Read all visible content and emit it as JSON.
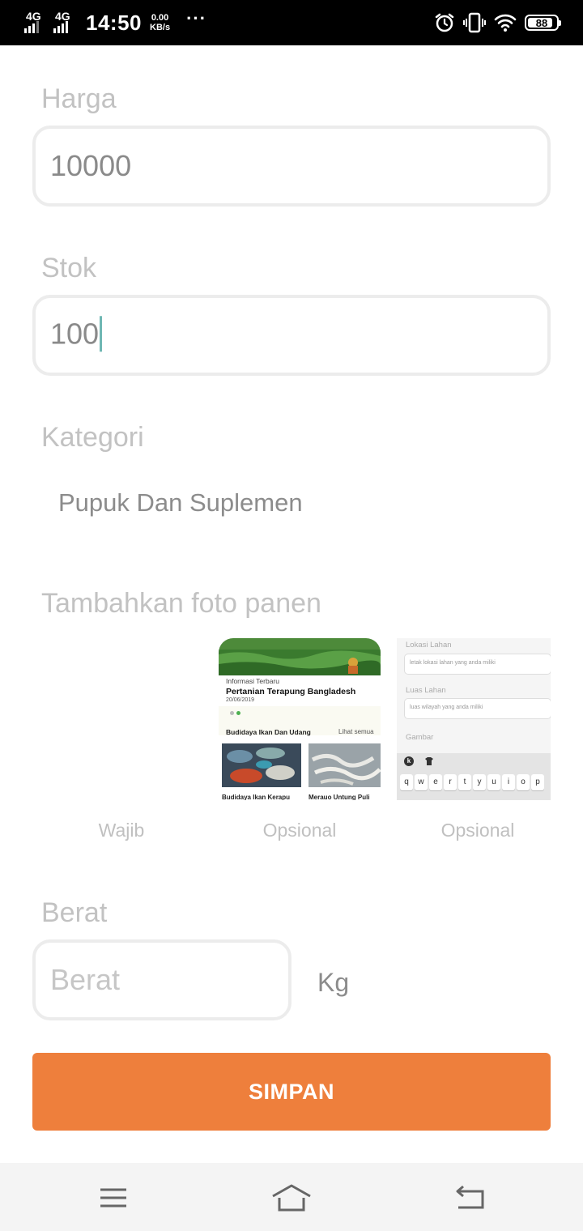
{
  "status_bar": {
    "network_1": "4G",
    "network_2": "4G",
    "time": "14:50",
    "speed_value": "0.00",
    "speed_unit": "KB/s",
    "more": "···",
    "battery_level": "88"
  },
  "form": {
    "harga": {
      "label": "Harga",
      "value": "10000"
    },
    "stok": {
      "label": "Stok",
      "value": "100"
    },
    "kategori": {
      "label": "Kategori",
      "selected": "Pupuk Dan Suplemen"
    },
    "photos": {
      "label": "Tambahkan foto panen",
      "slots": [
        {
          "caption": "Wajib"
        },
        {
          "caption": "Opsional",
          "thumb": {
            "header": "Informasi Terbaru",
            "title": "Pertanian Terapung Bangladesh",
            "date": "20/06/2019",
            "section": "Budidaya Ikan Dan Udang",
            "link": "Lihat semua",
            "card_1": "Budidaya Ikan Kerapu",
            "card_2": "Merauo Untung Puli"
          }
        },
        {
          "caption": "Opsional",
          "thumb": {
            "label_1": "Lokasi Lahan",
            "input_1": "letak lokasi lahan yang anda miliki",
            "label_2": "Luas Lahan",
            "input_2": "luas wilayah yang anda miliki",
            "label_3": "Gambar",
            "keys": [
              "q",
              "w",
              "e",
              "r",
              "t",
              "y",
              "u",
              "i",
              "o",
              "p"
            ]
          }
        }
      ]
    },
    "berat": {
      "label": "Berat",
      "placeholder": "Berat",
      "unit": "Kg"
    },
    "save_label": "SIMPAN"
  }
}
